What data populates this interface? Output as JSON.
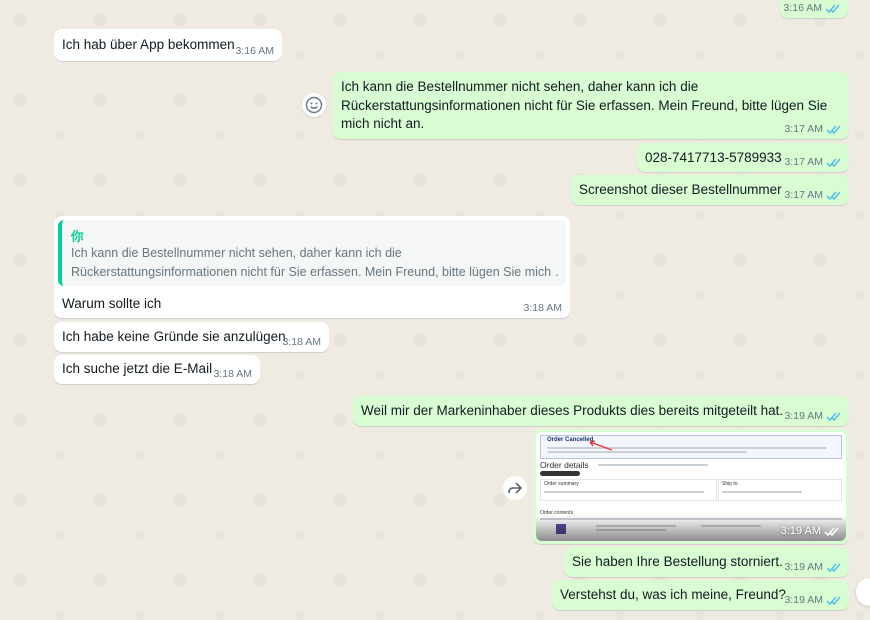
{
  "chat": {
    "top_status": {
      "time": "3:16 AM"
    },
    "messages": [
      {
        "dir": "in",
        "text": "Ich hab über App bekommen",
        "time": "3:16 AM"
      },
      {
        "dir": "out",
        "line1": "Ich kann die Bestellnummer nicht sehen, daher kann ich die",
        "line2": "Rückerstattungsinformationen nicht für Sie erfassen. Mein Freund, bitte lügen Sie",
        "line3": "mich nicht an.",
        "time": "3:17 AM"
      },
      {
        "dir": "out",
        "text": "028-7417713-5789933",
        "time": "3:17 AM"
      },
      {
        "dir": "out",
        "text": "Screenshot dieser Bestellnummer",
        "time": "3:17 AM"
      },
      {
        "dir": "in",
        "quote_author": "你",
        "quote_line1": "Ich kann die Bestellnummer nicht sehen, daher kann ich die",
        "quote_line2": "Rückerstattungsinformationen nicht für Sie erfassen. Mein Freund, bitte lügen Sie mich …",
        "text": "Warum sollte ich",
        "time": "3:18 AM"
      },
      {
        "dir": "in",
        "text": "Ich habe keine Gründe sie anzulügen",
        "time": "3:18 AM"
      },
      {
        "dir": "in",
        "text": "Ich suche jetzt die E-Mail",
        "time": "3:18 AM"
      },
      {
        "dir": "out",
        "text": "Weil mir der Markeninhaber dieses Produkts dies bereits mitgeteilt hat.",
        "time": "3:19 AM"
      },
      {
        "dir": "out",
        "type": "image",
        "time": "3:19 AM",
        "image": {
          "banner": "Order Cancelled",
          "heading": "Order details",
          "summary": "Order summary",
          "ship": "Ship to",
          "contents": "Order contents"
        }
      },
      {
        "dir": "out",
        "text": "Sie haben Ihre Bestellung storniert.",
        "time": "3:19 AM"
      },
      {
        "dir": "out",
        "text": "Verstehst du, was ich meine, Freund?",
        "time": "3:19 AM"
      }
    ]
  },
  "colors": {
    "incoming": "#ffffff",
    "outgoing": "#d9fdd3",
    "read_ticks": "#53bdeb",
    "background": "#efeae2",
    "quote_accent": "#06cf9c"
  }
}
